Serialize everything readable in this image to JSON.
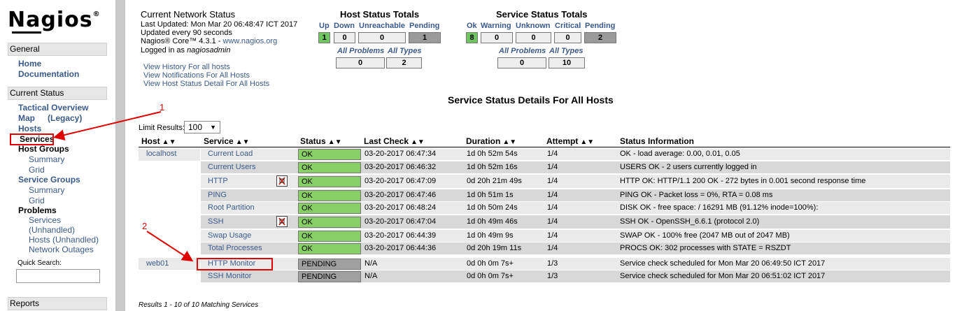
{
  "sidebar": {
    "logo": "Nagios",
    "logo_mark": "®",
    "general": {
      "header": "General",
      "home": "Home",
      "documentation": "Documentation"
    },
    "current_status": {
      "header": "Current Status",
      "tactical_overview": "Tactical Overview",
      "map": "Map",
      "map_legacy": "(Legacy)",
      "hosts": "Hosts",
      "services": "Services",
      "host_groups": "Host Groups",
      "host_groups_summary": "Summary",
      "host_groups_grid": "Grid",
      "service_groups": "Service Groups",
      "service_groups_summary": "Summary",
      "service_groups_grid": "Grid",
      "problems": "Problems",
      "problems_services": "Services",
      "problems_services_unhandled": "(Unhandled)",
      "problems_hosts_unhandled": "Hosts (Unhandled)",
      "problems_network_outages": "Network Outages",
      "quick_search_label": "Quick Search:"
    },
    "reports": {
      "header": "Reports"
    }
  },
  "status_info": {
    "title": "Current Network Status",
    "last_updated": "Last Updated: Mon Mar 20 06:48:47 ICT 2017",
    "update_interval": "Updated every 90 seconds",
    "version_prefix": "Nagios® Core™ 4.3.1 - ",
    "version_link": "www.nagios.org",
    "logged_in_prefix": "Logged in as ",
    "logged_in_user": "nagiosadmin",
    "links": [
      "View History For all hosts",
      "View Notifications For All Hosts",
      "View Host Status Detail For All Hosts"
    ]
  },
  "host_totals": {
    "title": "Host Status Totals",
    "headers": [
      "Up",
      "Down",
      "Unreachable",
      "Pending"
    ],
    "values": [
      "1",
      "0",
      "0",
      "1"
    ],
    "all_problems_label": "All Problems",
    "all_types_label": "All Types",
    "all_problems": "0",
    "all_types": "2"
  },
  "service_totals": {
    "title": "Service Status Totals",
    "headers": [
      "Ok",
      "Warning",
      "Unknown",
      "Critical",
      "Pending"
    ],
    "values": [
      "8",
      "0",
      "0",
      "0",
      "2"
    ],
    "all_problems_label": "All Problems",
    "all_types_label": "All Types",
    "all_problems": "0",
    "all_types": "10"
  },
  "page_heading": "Service Status Details For All Hosts",
  "limit": {
    "label": "Limit Results:",
    "value": "100"
  },
  "table": {
    "headers": [
      "Host",
      "Service",
      "Status",
      "Last Check",
      "Duration",
      "Attempt",
      "Status Information"
    ],
    "rows": [
      {
        "host": "localhost",
        "service": "Current Load",
        "status": "OK",
        "last_check": "03-20-2017 06:47:34",
        "duration": "1d 0h 52m 54s",
        "attempt": "1/4",
        "info": "OK - load average: 0.00, 0.01, 0.05"
      },
      {
        "host": "",
        "service": "Current Users",
        "status": "OK",
        "last_check": "03-20-2017 06:46:32",
        "duration": "1d 0h 52m 16s",
        "attempt": "1/4",
        "info": "USERS OK - 2 users currently logged in"
      },
      {
        "host": "",
        "service": "HTTP",
        "status": "OK",
        "last_check": "03-20-2017 06:47:09",
        "duration": "0d 20h 21m 49s",
        "attempt": "1/4",
        "info": "HTTP OK: HTTP/1.1 200 OK - 272 bytes in 0.001 second response time"
      },
      {
        "host": "",
        "service": "PING",
        "status": "OK",
        "last_check": "03-20-2017 06:47:46",
        "duration": "1d 0h 51m 1s",
        "attempt": "1/4",
        "info": "PING OK - Packet loss = 0%, RTA = 0.08 ms"
      },
      {
        "host": "",
        "service": "Root Partition",
        "status": "OK",
        "last_check": "03-20-2017 06:48:24",
        "duration": "1d 0h 50m 24s",
        "attempt": "1/4",
        "info": "DISK OK - free space: / 16291 MB (91.12% inode=100%):"
      },
      {
        "host": "",
        "service": "SSH",
        "status": "OK",
        "last_check": "03-20-2017 06:47:04",
        "duration": "1d 0h 49m 46s",
        "attempt": "1/4",
        "info": "SSH OK - OpenSSH_6.6.1 (protocol 2.0)"
      },
      {
        "host": "",
        "service": "Swap Usage",
        "status": "OK",
        "last_check": "03-20-2017 06:44:39",
        "duration": "1d 0h 49m 9s",
        "attempt": "1/4",
        "info": "SWAP OK - 100% free (2047 MB out of 2047 MB)"
      },
      {
        "host": "",
        "service": "Total Processes",
        "status": "OK",
        "last_check": "03-20-2017 06:44:36",
        "duration": "0d 20h 19m 11s",
        "attempt": "1/4",
        "info": "PROCS OK: 302 processes with STATE = RSZDT"
      },
      {
        "host": "web01",
        "service": "HTTP Monitor",
        "status": "PENDING",
        "last_check": "N/A",
        "duration": "0d 0h 0m 7s+",
        "attempt": "1/3",
        "info": "Service check scheduled for Mon Mar 20 06:49:50 ICT 2017"
      },
      {
        "host": "",
        "service": "SSH Monitor",
        "status": "PENDING",
        "last_check": "N/A",
        "duration": "0d 0h 0m 7s+",
        "attempt": "1/3",
        "info": "Service check scheduled for Mon Mar 20 06:51:02 ICT 2017"
      }
    ]
  },
  "footer": "Results 1 - 10 of 10 Matching Services",
  "annotations": [
    "1",
    "2"
  ],
  "colors": {
    "ok": "#88d066",
    "pending": "#a0a0a0",
    "link": "#3b5a8a",
    "annotation": "#e00000"
  }
}
